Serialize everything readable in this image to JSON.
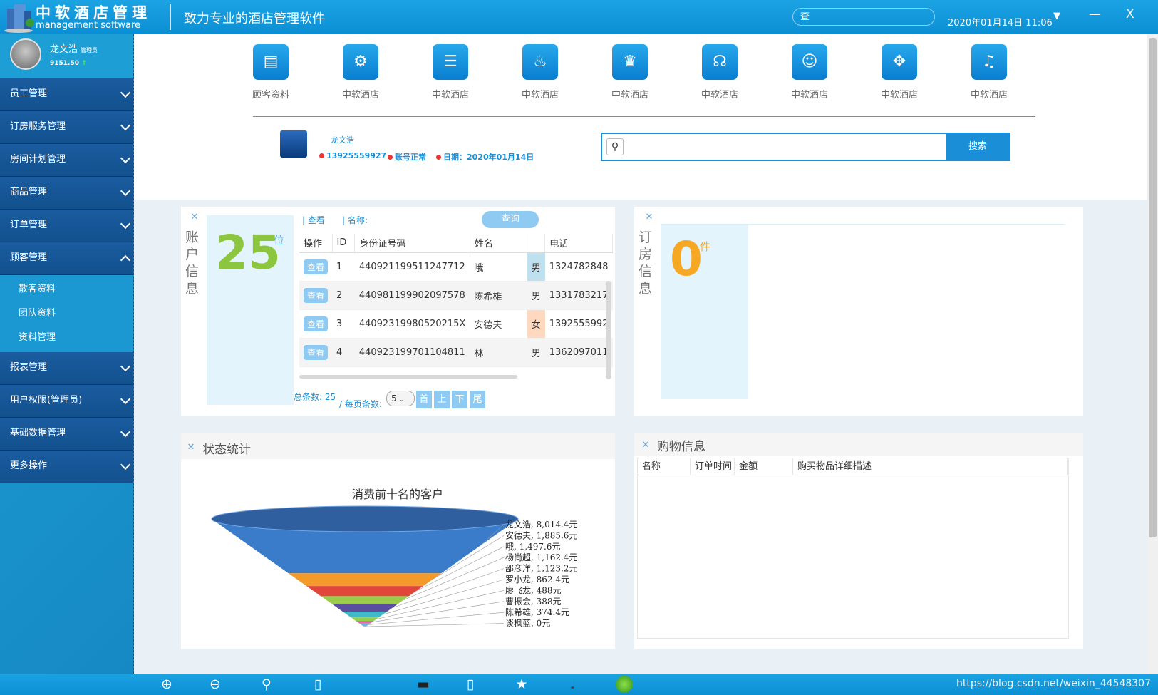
{
  "header": {
    "brand": "中软酒店管理",
    "brand_sub": "management software",
    "slogan": "致力专业的酒店管理软件",
    "search_value": "查",
    "datetime": "2020年01月14日 11:06",
    "dropdown": "▼",
    "minimize": "—",
    "close": "X"
  },
  "user": {
    "name": "龙文浩",
    "role": "管理员",
    "balance": "9151.50",
    "balance_arrow": "↑"
  },
  "menu": [
    {
      "label": "员工管理"
    },
    {
      "label": "订房服务管理"
    },
    {
      "label": "房间计划管理"
    },
    {
      "label": "商品管理"
    },
    {
      "label": "订单管理"
    },
    {
      "label": "顾客管理",
      "expanded": true
    }
  ],
  "submenu": [
    {
      "label": "散客资料"
    },
    {
      "label": "团队资料"
    },
    {
      "label": "资料管理"
    }
  ],
  "menu2": [
    {
      "label": "报表管理"
    },
    {
      "label": "用户权限(管理员)"
    },
    {
      "label": "基础数据管理"
    },
    {
      "label": "更多操作"
    }
  ],
  "tools": [
    {
      "label": "顾客资料",
      "icon": "book-icon"
    },
    {
      "label": "中软酒店",
      "icon": "gears-icon"
    },
    {
      "label": "中软酒店",
      "icon": "server-icon"
    },
    {
      "label": "中软酒店",
      "icon": "flame-icon"
    },
    {
      "label": "中软酒店",
      "icon": "trophy-icon"
    },
    {
      "label": "中软酒店",
      "icon": "headset-icon"
    },
    {
      "label": "中软酒店",
      "icon": "user-icon"
    },
    {
      "label": "中软酒店",
      "icon": "cross-icon"
    },
    {
      "label": "中软酒店",
      "icon": "bell-icon"
    }
  ],
  "profile": {
    "name": "龙文浩",
    "phone": "13925559927",
    "status": "账号正常",
    "date": "日期：2020年01月14日"
  },
  "search": {
    "button": "搜索"
  },
  "account": {
    "title": "账户信息",
    "count": "25",
    "unit": "位",
    "view_link": "| 查看",
    "name_link": "| 名称:",
    "query": "查询",
    "columns": [
      "操作",
      "ID",
      "身份证号码",
      "姓名",
      "",
      "电话"
    ],
    "rows": [
      {
        "op": "查看",
        "id": "1",
        "idcard": "440921199511247712",
        "name": "哦",
        "sex": "男",
        "phone": "1324782848"
      },
      {
        "op": "查看",
        "id": "2",
        "idcard": "440981199902097578",
        "name": "陈希雄",
        "sex": "男",
        "phone": "1331783217"
      },
      {
        "op": "查看",
        "id": "3",
        "idcard": "44092319980520215X",
        "name": "安德夫",
        "sex": "女",
        "phone": "1392555992"
      },
      {
        "op": "查看",
        "id": "4",
        "idcard": "440923199701104811",
        "name": "林",
        "sex": "男",
        "phone": "1362097011"
      }
    ],
    "total_label": "总条数:",
    "total": "25",
    "per_page_label": "/ 每页条数:",
    "per_page": "5",
    "pager": [
      "首",
      "上",
      "下",
      "尾"
    ]
  },
  "booking": {
    "title": "订房信息",
    "count": "0",
    "unit": "件"
  },
  "stats": {
    "title": "状态统计"
  },
  "shopping": {
    "title": "购物信息",
    "columns": [
      "名称",
      "订单时间",
      "金额",
      "购买物品详细描述"
    ]
  },
  "chart_data": {
    "type": "funnel",
    "title": "消费前十名的客户",
    "unit": "元",
    "categories": [
      "龙文浩",
      "安德夫",
      "哦",
      "杨尚超",
      "邵彦洋",
      "罗小龙",
      "廖飞龙",
      "曹振会",
      "陈希雄",
      "谈枫蓝"
    ],
    "values": [
      8014.4,
      1885.6,
      1497.6,
      1162.4,
      1123.2,
      862.4,
      488,
      388,
      374.4,
      0
    ],
    "labels": [
      "龙文浩, 8,014.4元",
      "安德夫, 1,885.6元",
      "哦, 1,497.6元",
      "杨尚超, 1,162.4元",
      "邵彦洋, 1,123.2元",
      "罗小龙, 862.4元",
      "廖飞龙, 488元",
      "曹振会, 388元",
      "陈希雄, 374.4元",
      "谈枫蓝, 0元"
    ],
    "colors": [
      "#3a7cc9",
      "#f39a2b",
      "#e0473a",
      "#9bcb4c",
      "#5b4ea0",
      "#40b9c9",
      "#8fd14f",
      "#e86a9e",
      "#6fb0e6",
      "#b8b8b8"
    ]
  },
  "watermark": "https://blog.csdn.net/weixin_44548307",
  "bottom_icons": [
    "zoom-in-icon",
    "zoom-out-icon",
    "search-icon",
    "phone-icon",
    "gamepad-icon",
    "tablet-icon",
    "star-icon",
    "microphone-icon",
    "globe-icon"
  ]
}
